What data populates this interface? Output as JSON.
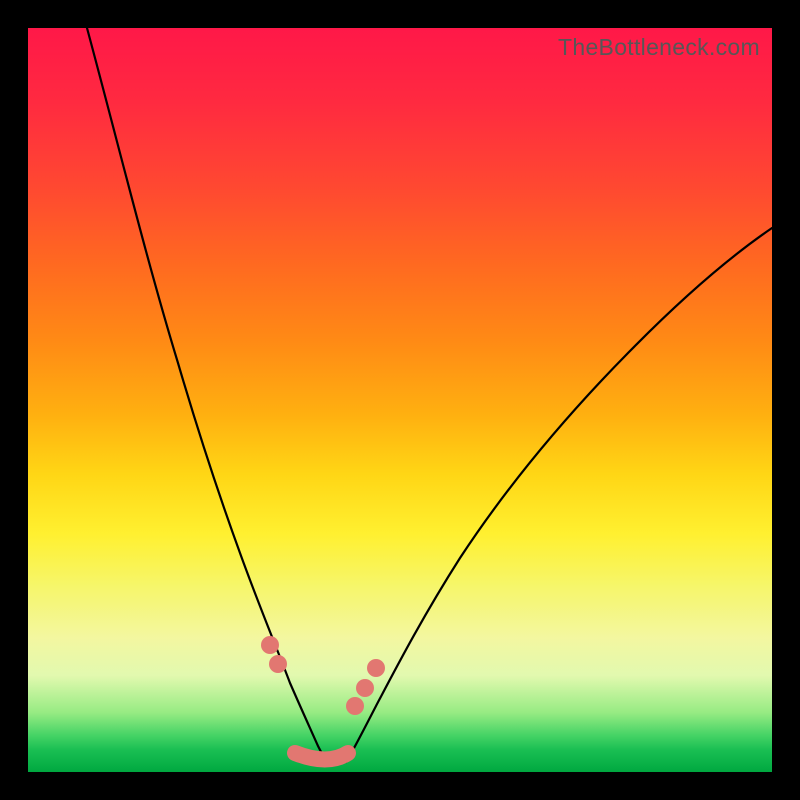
{
  "watermark": {
    "text": "TheBottleneck.com"
  },
  "colors": {
    "bead": "#e27771",
    "curve": "#000000",
    "frame": "#000000"
  },
  "chart_data": {
    "type": "line",
    "title": "",
    "xlabel": "",
    "ylabel": "",
    "xlim": [
      0,
      100
    ],
    "ylim": [
      0,
      100
    ],
    "grid": false,
    "background": "heatmap-gradient",
    "curves": [
      {
        "name": "left-curve",
        "x": [
          8,
          12,
          16,
          20,
          23,
          26,
          28,
          30,
          32,
          33.5,
          35,
          36.5,
          38,
          39
        ],
        "y": [
          100,
          84,
          69,
          55,
          44,
          34,
          27,
          21,
          15.5,
          11.5,
          8.2,
          5.4,
          3.2,
          1.8
        ]
      },
      {
        "name": "right-curve",
        "x": [
          42,
          44,
          46,
          49,
          53,
          58,
          64,
          72,
          82,
          92,
          100
        ],
        "y": [
          1.8,
          4.0,
          7.2,
          12.0,
          18.5,
          26.5,
          35.0,
          45.0,
          56.0,
          65.5,
          72.5
        ]
      }
    ],
    "annotations": {
      "beads_left": [
        {
          "x": 32.0,
          "y": 16.5
        },
        {
          "x": 33.3,
          "y": 13.5
        }
      ],
      "beads_right": [
        {
          "x": 43.0,
          "y": 8.0
        },
        {
          "x": 44.3,
          "y": 10.5
        },
        {
          "x": 45.8,
          "y": 13.2
        }
      ],
      "footline": {
        "x0": 34.5,
        "x1": 42.0,
        "y": 2.0
      }
    }
  }
}
